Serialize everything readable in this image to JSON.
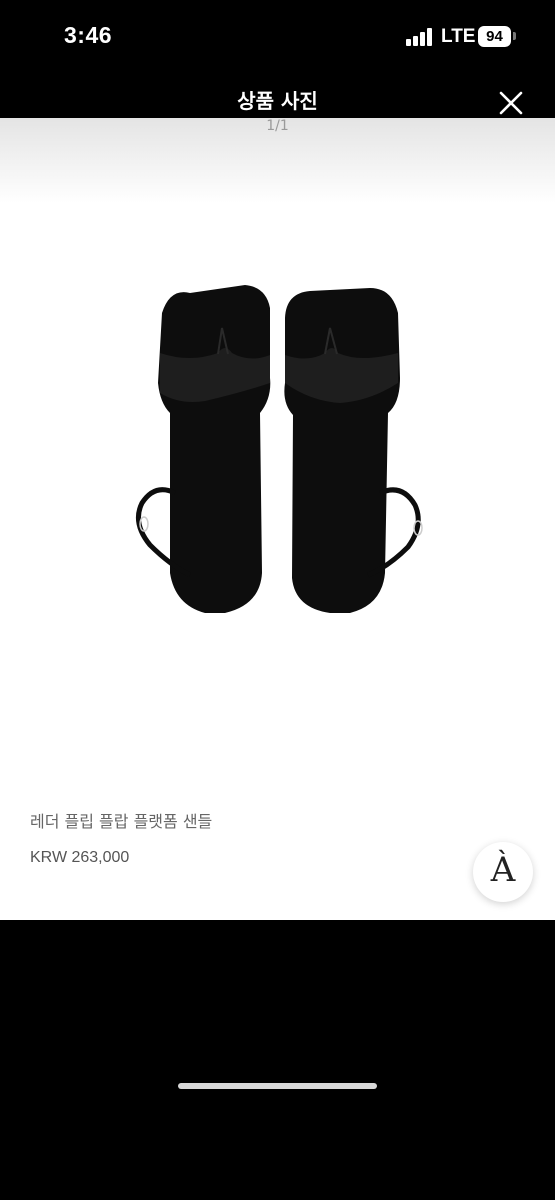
{
  "status_bar": {
    "time": "3:46",
    "network": "LTE",
    "battery": "94",
    "signal_bars": 4
  },
  "viewer": {
    "title": "상품 사진",
    "counter": "1/1"
  },
  "product": {
    "name": "레더 플립 플랍 플랫폼 샌들",
    "price": "KRW 263,000",
    "brand_mark": "À",
    "image": "black-leather-flip-flop-platform-sandals"
  },
  "colors": {
    "background": "#000000",
    "photo_background": "#ffffff",
    "sandal": "#0d0d0d"
  }
}
